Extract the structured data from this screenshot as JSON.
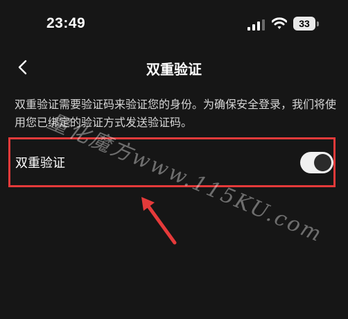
{
  "status_bar": {
    "time": "23:49",
    "battery_level": "33",
    "icons": [
      "signal-icon",
      "wifi-icon",
      "battery-icon"
    ]
  },
  "nav": {
    "back_icon": "chevron-left-icon",
    "title": "双重验证"
  },
  "description": "双重验证需要验证码来验证您的身份。为确保安全登录，我们将使用您已绑定的验证方式发送验证码。",
  "setting": {
    "label": "双重验证",
    "toggle_on": true
  },
  "annotation": {
    "highlight_color": "#e53a3a",
    "arrow_color": "#e53a3a"
  },
  "watermark": "量化魔方www.115KU.com"
}
